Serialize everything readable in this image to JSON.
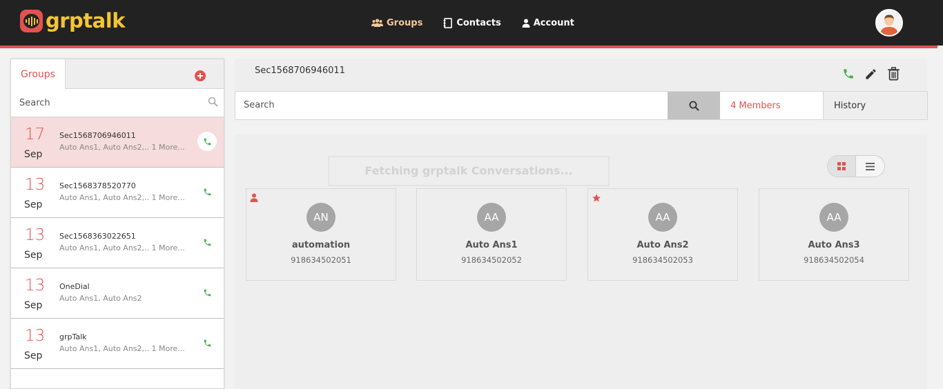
{
  "app": {
    "name": "grptalk"
  },
  "nav": {
    "groups": "Groups",
    "contacts": "Contacts",
    "account": "Account"
  },
  "left": {
    "tab_label": "Groups",
    "search_placeholder": "Search",
    "groups": [
      {
        "day": "17",
        "month": "Sep",
        "name": "Sec1568706946011",
        "members": "Auto Ans1, Auto Ans2,.. 1 More..."
      },
      {
        "day": "13",
        "month": "Sep",
        "name": "Sec1568378520770",
        "members": "Auto Ans1, Auto Ans2,.. 1 More..."
      },
      {
        "day": "13",
        "month": "Sep",
        "name": "Sec1568363022651",
        "members": "Auto Ans1, Auto Ans2,.. 1 More..."
      },
      {
        "day": "13",
        "month": "Sep",
        "name": "OneDial",
        "members": "Auto Ans1, Auto Ans2"
      },
      {
        "day": "13",
        "month": "Sep",
        "name": "grpTalk",
        "members": "Auto Ans1, Auto Ans2,.. 1 More..."
      }
    ]
  },
  "main": {
    "title": "Sec1568706946011",
    "search_placeholder": "Search",
    "members_count": "4 Members",
    "history": "History",
    "fetching": "Fetching grptalk Conversations...",
    "members": [
      {
        "initials": "AN",
        "name": "automation",
        "phone": "918634502051",
        "badge": "user-icon"
      },
      {
        "initials": "AA",
        "name": "Auto Ans1",
        "phone": "918634502052",
        "badge": ""
      },
      {
        "initials": "AA",
        "name": "Auto Ans2",
        "phone": "918634502053",
        "badge": "star-icon"
      },
      {
        "initials": "AA",
        "name": "Auto Ans3",
        "phone": "918634502054",
        "badge": ""
      }
    ]
  },
  "colors": {
    "accent": "#e4524f",
    "logo": "#f5c530",
    "call": "#4caf50",
    "topbar": "#222222"
  }
}
